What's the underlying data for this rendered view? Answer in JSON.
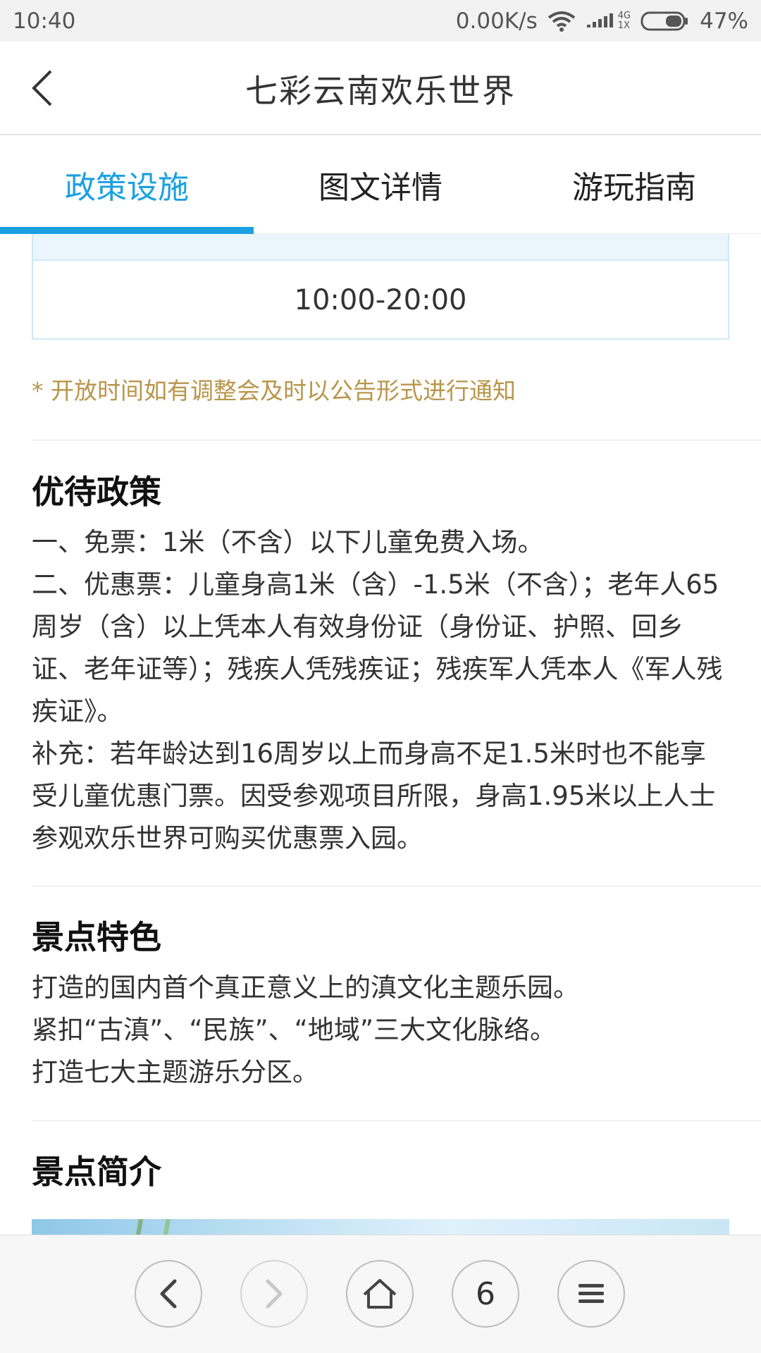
{
  "status_bar": {
    "time": "10:40",
    "net_speed": "0.00K/s",
    "net_type_top": "4G",
    "net_type_bottom": "1X",
    "battery": "47%"
  },
  "header": {
    "title": "七彩云南欢乐世界"
  },
  "tabs": [
    {
      "label": "政策设施",
      "active": true
    },
    {
      "label": "图文详情",
      "active": false
    },
    {
      "label": "游玩指南",
      "active": false
    }
  ],
  "hours": {
    "value": "10:00-20:00",
    "notice": "* 开放时间如有调整会及时以公告形式进行通知"
  },
  "sections": {
    "policy": {
      "title": "优待政策",
      "lines": [
        "一、免票：1米（不含）以下儿童免费入场。",
        "二、优惠票：儿童身高1米（含）-1.5米（不含）；老年人65周岁（含）以上凭本人有效身份证（身份证、护照、回乡证、老年证等）；残疾人凭残疾证；残疾军人凭本人《军人残疾证》。",
        "补充：若年龄达到16周岁以上而身高不足1.5米时也不能享受儿童优惠门票。因受参观项目所限，身高1.95米以上人士参观欢乐世界可购买优惠票入园。"
      ]
    },
    "features": {
      "title": "景点特色",
      "lines": [
        "打造的国内首个真正意义上的滇文化主题乐园。",
        "紧扣“古滇”、“民族”、“地域”三大文化脉络。",
        "打造七大主题游乐分区。"
      ]
    },
    "intro": {
      "title": "景点简介"
    }
  },
  "bottom_nav": {
    "tab_count": "6",
    "icons": [
      "chevron-left-icon",
      "chevron-right-icon",
      "home-icon",
      "tabs-count",
      "menu-icon"
    ]
  },
  "colors": {
    "accent": "#1ba0e1",
    "notice": "#b8954a"
  }
}
